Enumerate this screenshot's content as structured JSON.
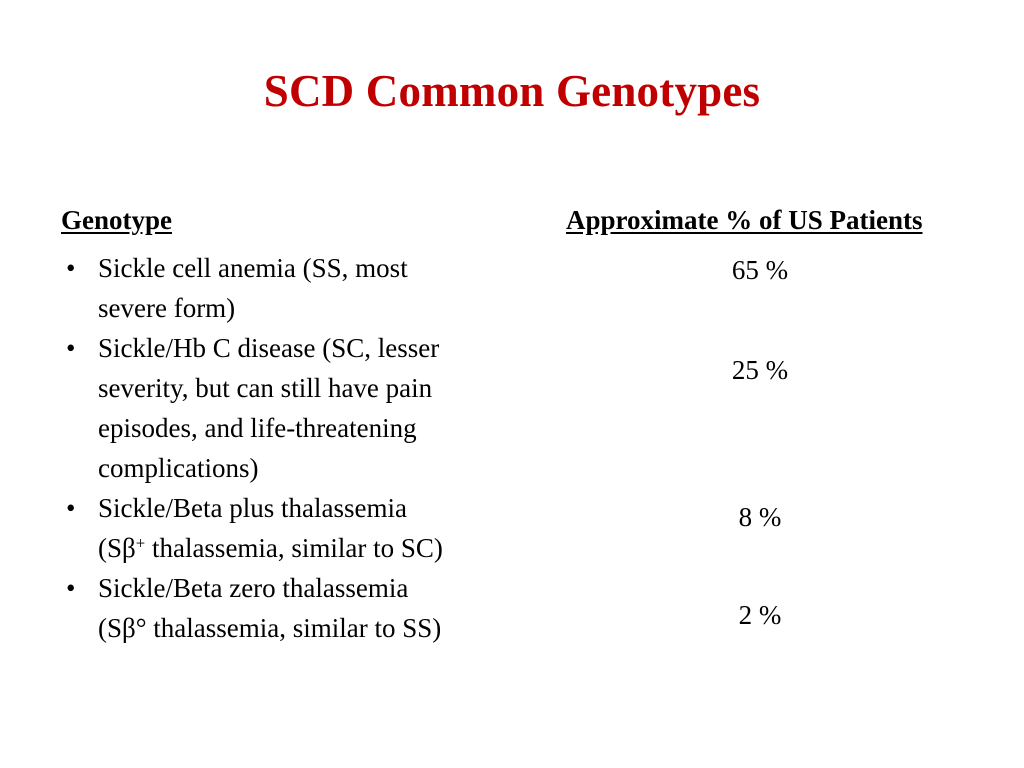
{
  "slide": {
    "title": "SCD Common Genotypes",
    "title_color": "#C00000",
    "background_color": "#FFFFFF",
    "text_color": "#000000"
  },
  "columns": {
    "genotype_header": "Genotype",
    "percent_header": "Approximate % of US Patients"
  },
  "bullet_marker": "•",
  "rows": [
    {
      "genotype_line_1": "Sickle cell anemia (SS, most",
      "genotype_line_2": "severe form)",
      "percent": "65 %"
    },
    {
      "genotype_line_1": "Sickle/Hb C disease (SC, lesser",
      "genotype_line_2": "severity, but can still have pain",
      "genotype_line_3": "episodes, and life-threatening",
      "genotype_line_4": "complications)",
      "percent": "25 %"
    },
    {
      "genotype_line_1": "Sickle/Beta plus thalassemia",
      "genotype_line_2_pre": "(Sβ",
      "genotype_line_2_sup": "+",
      "genotype_line_2_post": " thalassemia, similar to SC)",
      "percent": "8 %"
    },
    {
      "genotype_line_1": "Sickle/Beta zero thalassemia",
      "genotype_line_2": "(Sβ° thalassemia, similar to SS)",
      "percent": "2 %"
    }
  ]
}
